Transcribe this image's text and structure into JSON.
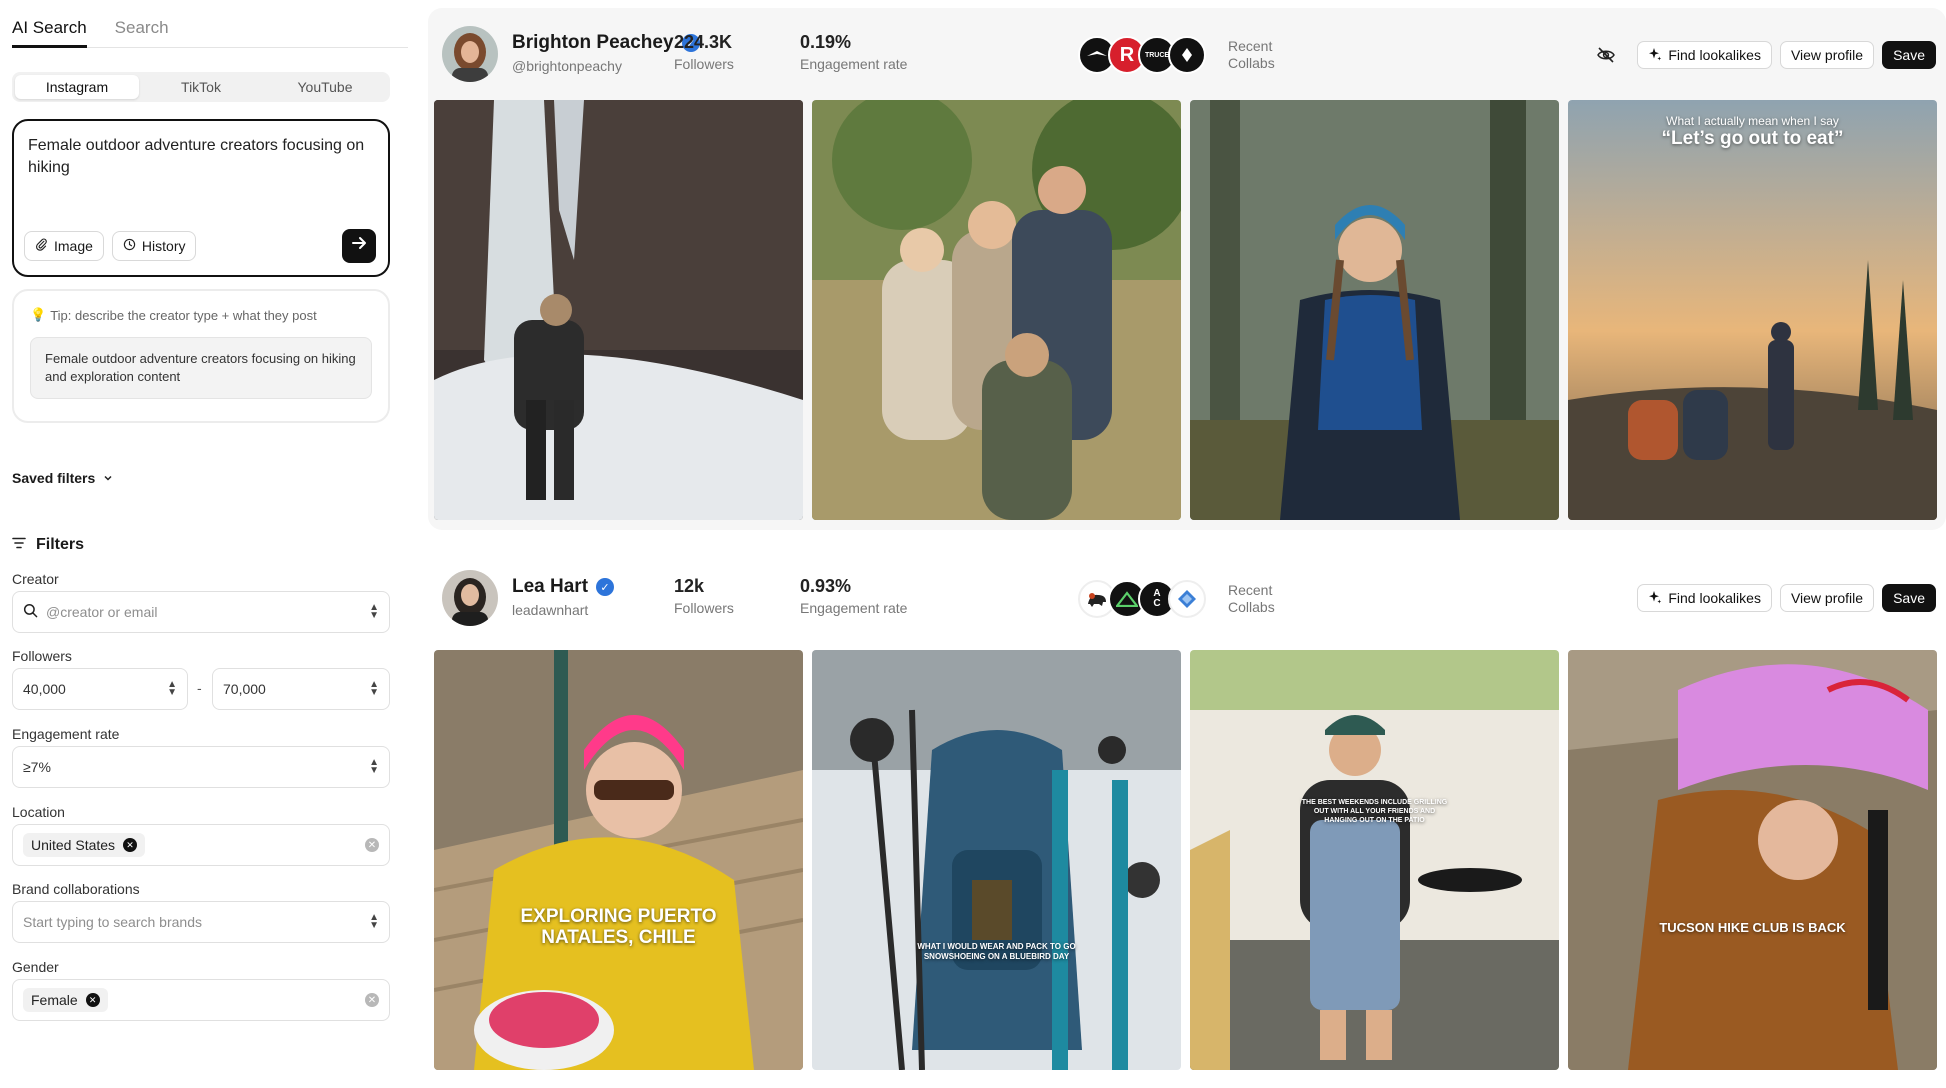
{
  "sidebar": {
    "main_tabs": [
      "AI Search",
      "Search"
    ],
    "platform_tabs": [
      "Instagram",
      "TikTok",
      "YouTube"
    ],
    "prompt": "Female outdoor adventure creators focusing on hiking",
    "image_label": "Image",
    "history_label": "History",
    "tip_title": "Tip: describe the creator type + what they post",
    "tip_example": "Female outdoor adventure creators focusing on hiking and exploration content",
    "saved_filters": "Saved filters",
    "filters_title": "Filters",
    "creator_label": "Creator",
    "creator_placeholder": "@creator or email",
    "followers_label": "Followers",
    "followers_min": "40,000",
    "followers_sep": "-",
    "followers_max": "70,000",
    "engagement_label": "Engagement rate",
    "engagement_value": "≥7%",
    "location_label": "Location",
    "location_tag": "United States",
    "brand_label": "Brand collaborations",
    "brand_placeholder": "Start typing to search brands",
    "gender_label": "Gender",
    "gender_tag": "Female"
  },
  "creators": [
    {
      "name": "Brighton Peachey",
      "handle": "@brightonpeachy",
      "followers": "224.3K",
      "followers_label": "Followers",
      "engagement": "0.19%",
      "engagement_label": "Engagement rate",
      "collabs_label": "Recent Collabs",
      "collab_logos": [
        "osprey",
        "R",
        "TRUCE",
        "diamond"
      ],
      "photo_texts": {
        "p4_small": "What I actually mean when I say",
        "p4_big": "“Let’s go out to eat”"
      }
    },
    {
      "name": "Lea Hart",
      "handle": "leadawnhart",
      "followers": "12k",
      "followers_label": "Followers",
      "engagement": "0.93%",
      "engagement_label": "Engagement rate",
      "collabs_label": "Recent Collabs",
      "collab_logos": [
        "bear",
        "mountain",
        "A C",
        "diamond-blue"
      ],
      "photo_texts": {
        "p1": "EXPLORING PUERTO NATALES, CHILE",
        "p2": "WHAT I WOULD WEAR AND PACK TO GO SNOWSHOEING ON A BLUEBIRD DAY",
        "p3": "THE BEST WEEKENDS INCLUDE GRILLING OUT WITH ALL YOUR FRIENDS AND HANGING OUT ON THE PATIO",
        "p4": "TUCSON HIKE CLUB IS BACK"
      }
    }
  ],
  "actions": {
    "find_lookalikes": "Find lookalikes",
    "view_profile": "View profile",
    "save": "Save"
  },
  "colors": {
    "accent": "#111111",
    "verified": "#2d74da",
    "card_bg": "#f6f6f6"
  }
}
